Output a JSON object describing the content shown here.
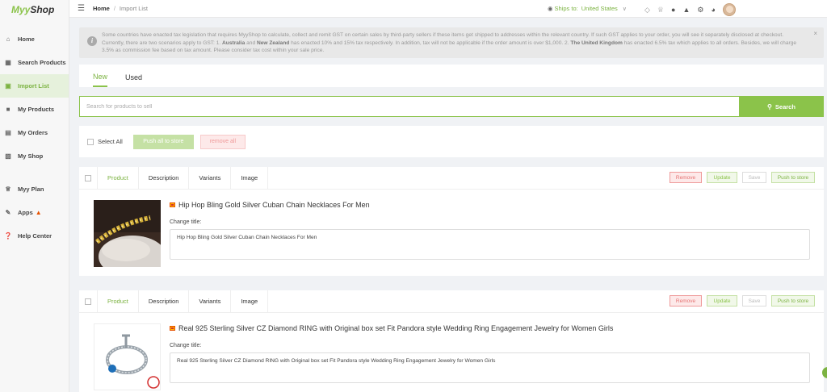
{
  "app": {
    "logo_prefix": "Myy",
    "logo_suffix": "Shop"
  },
  "sidebar": {
    "items": [
      {
        "label": "Home",
        "icon": "home-icon",
        "active": false
      },
      {
        "label": "Search Products",
        "icon": "grid-icon",
        "active": false
      },
      {
        "label": "Import List",
        "icon": "import-icon",
        "active": true
      },
      {
        "label": "My Products",
        "icon": "box-icon",
        "active": false
      },
      {
        "label": "My Orders",
        "icon": "orders-icon",
        "active": false
      },
      {
        "label": "My Shop",
        "icon": "shop-icon",
        "active": false
      },
      {
        "label": "Myy Plan",
        "icon": "crown-icon",
        "active": false
      },
      {
        "label": "Apps",
        "icon": "thumbs-up-icon",
        "active": false
      },
      {
        "label": "Help Center",
        "icon": "help-icon",
        "active": false
      }
    ]
  },
  "topbar": {
    "breadcrumb_home": "Home",
    "breadcrumb_sep": "/",
    "breadcrumb_current": "Import List",
    "ships_to_label": "Ships to:",
    "ships_to_country": "United States"
  },
  "notice": {
    "part1": "Some countries have enacted tax legislation that requires MyyShop to calculate, collect and remit GST on certain sales by third-party sellers if these items get shipped to addresses within the relevant country. If such GST applies to your order, you will see it separately disclosed at checkout. Currently, there are two scenarios apply to GST: 1.",
    "bold1": "Australia",
    "part2": "and",
    "bold2": "New Zealand",
    "part3": "has enacted 10% and 15% tax respectively. In addition, tax will not be applicable if the order amount is over $1,000. 2.",
    "bold3": "The United Kingdom",
    "part4": "has enacted 6.5% tax which applies to all orders. Besides, we will charge 3.5% as commission fee based on tax amount. Please consider tax cost within your sale price.",
    "close": "×"
  },
  "tabs": {
    "new": "New",
    "used": "Used"
  },
  "search": {
    "placeholder": "Search for products to sell",
    "button": "Search"
  },
  "bulk": {
    "select_all": "Select All",
    "push_all": "Push all to store",
    "remove_all": "remove all"
  },
  "card_tabs": {
    "product": "Product",
    "description": "Description",
    "variants": "Variants",
    "image": "Image"
  },
  "card_actions": {
    "remove": "Remove",
    "update": "Update",
    "save": "Save",
    "push": "Push to store"
  },
  "products": [
    {
      "title": "Hip Hop Bling Gold Silver Cuban Chain Necklaces For Men",
      "change_title_label": "Change title:",
      "title_value": "Hip Hop Bling Gold Silver Cuban Chain Necklaces For Men"
    },
    {
      "title": "Real 925 Sterling Silver CZ Diamond RING with Original box set Fit Pandora style Wedding Ring Engagement Jewelry for Women Girls",
      "change_title_label": "Change title:",
      "title_value": "Real 925 Sterling Silver CZ Diamond RING with Original box set Fit Pandora style Wedding Ring Engagement Jewelry for Women Girls"
    }
  ],
  "colors": {
    "accent": "#8bc34a",
    "danger": "#e57373"
  }
}
